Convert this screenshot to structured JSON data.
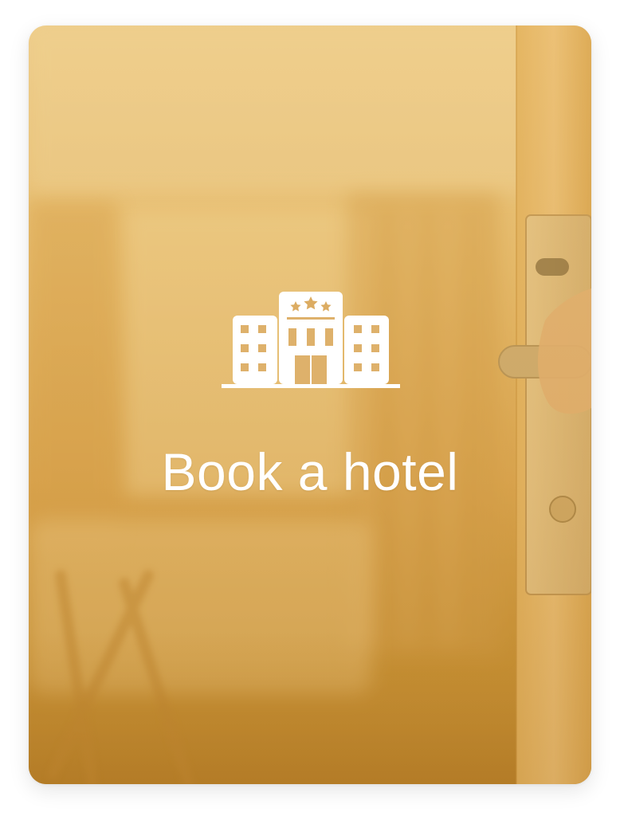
{
  "card": {
    "title": "Book a hotel",
    "icon": "hotel-building-icon",
    "accent_color": "#d9a452",
    "background_image": "hotel-room-door-photo"
  }
}
